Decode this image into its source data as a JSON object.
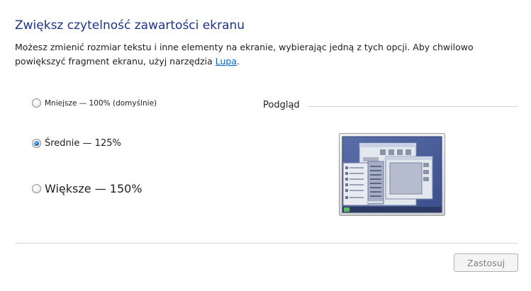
{
  "header": {
    "title": "Zwiększ czytelność zawartości ekranu",
    "description_prefix": "Możesz zmienić rozmiar tekstu i inne elementy na ekranie, wybierając jedną z tych opcji. Aby chwilowo powiększyć fragment ekranu, użyj narzędzia ",
    "description_link": "Lupa",
    "description_suffix": "."
  },
  "options": [
    {
      "label": "Mniejsze — 100% (domyślnie)",
      "checked": false
    },
    {
      "label": "Średnie — 125%",
      "checked": true
    },
    {
      "label": "Większe — 150%",
      "checked": false
    }
  ],
  "preview": {
    "label": "Podgląd"
  },
  "footer": {
    "apply_label": "Zastosuj",
    "apply_enabled": false
  },
  "colors": {
    "title": "#1e3287",
    "link": "#0066cc",
    "radio_selected": "#2f7cc7",
    "divider": "#d5d5d5"
  }
}
